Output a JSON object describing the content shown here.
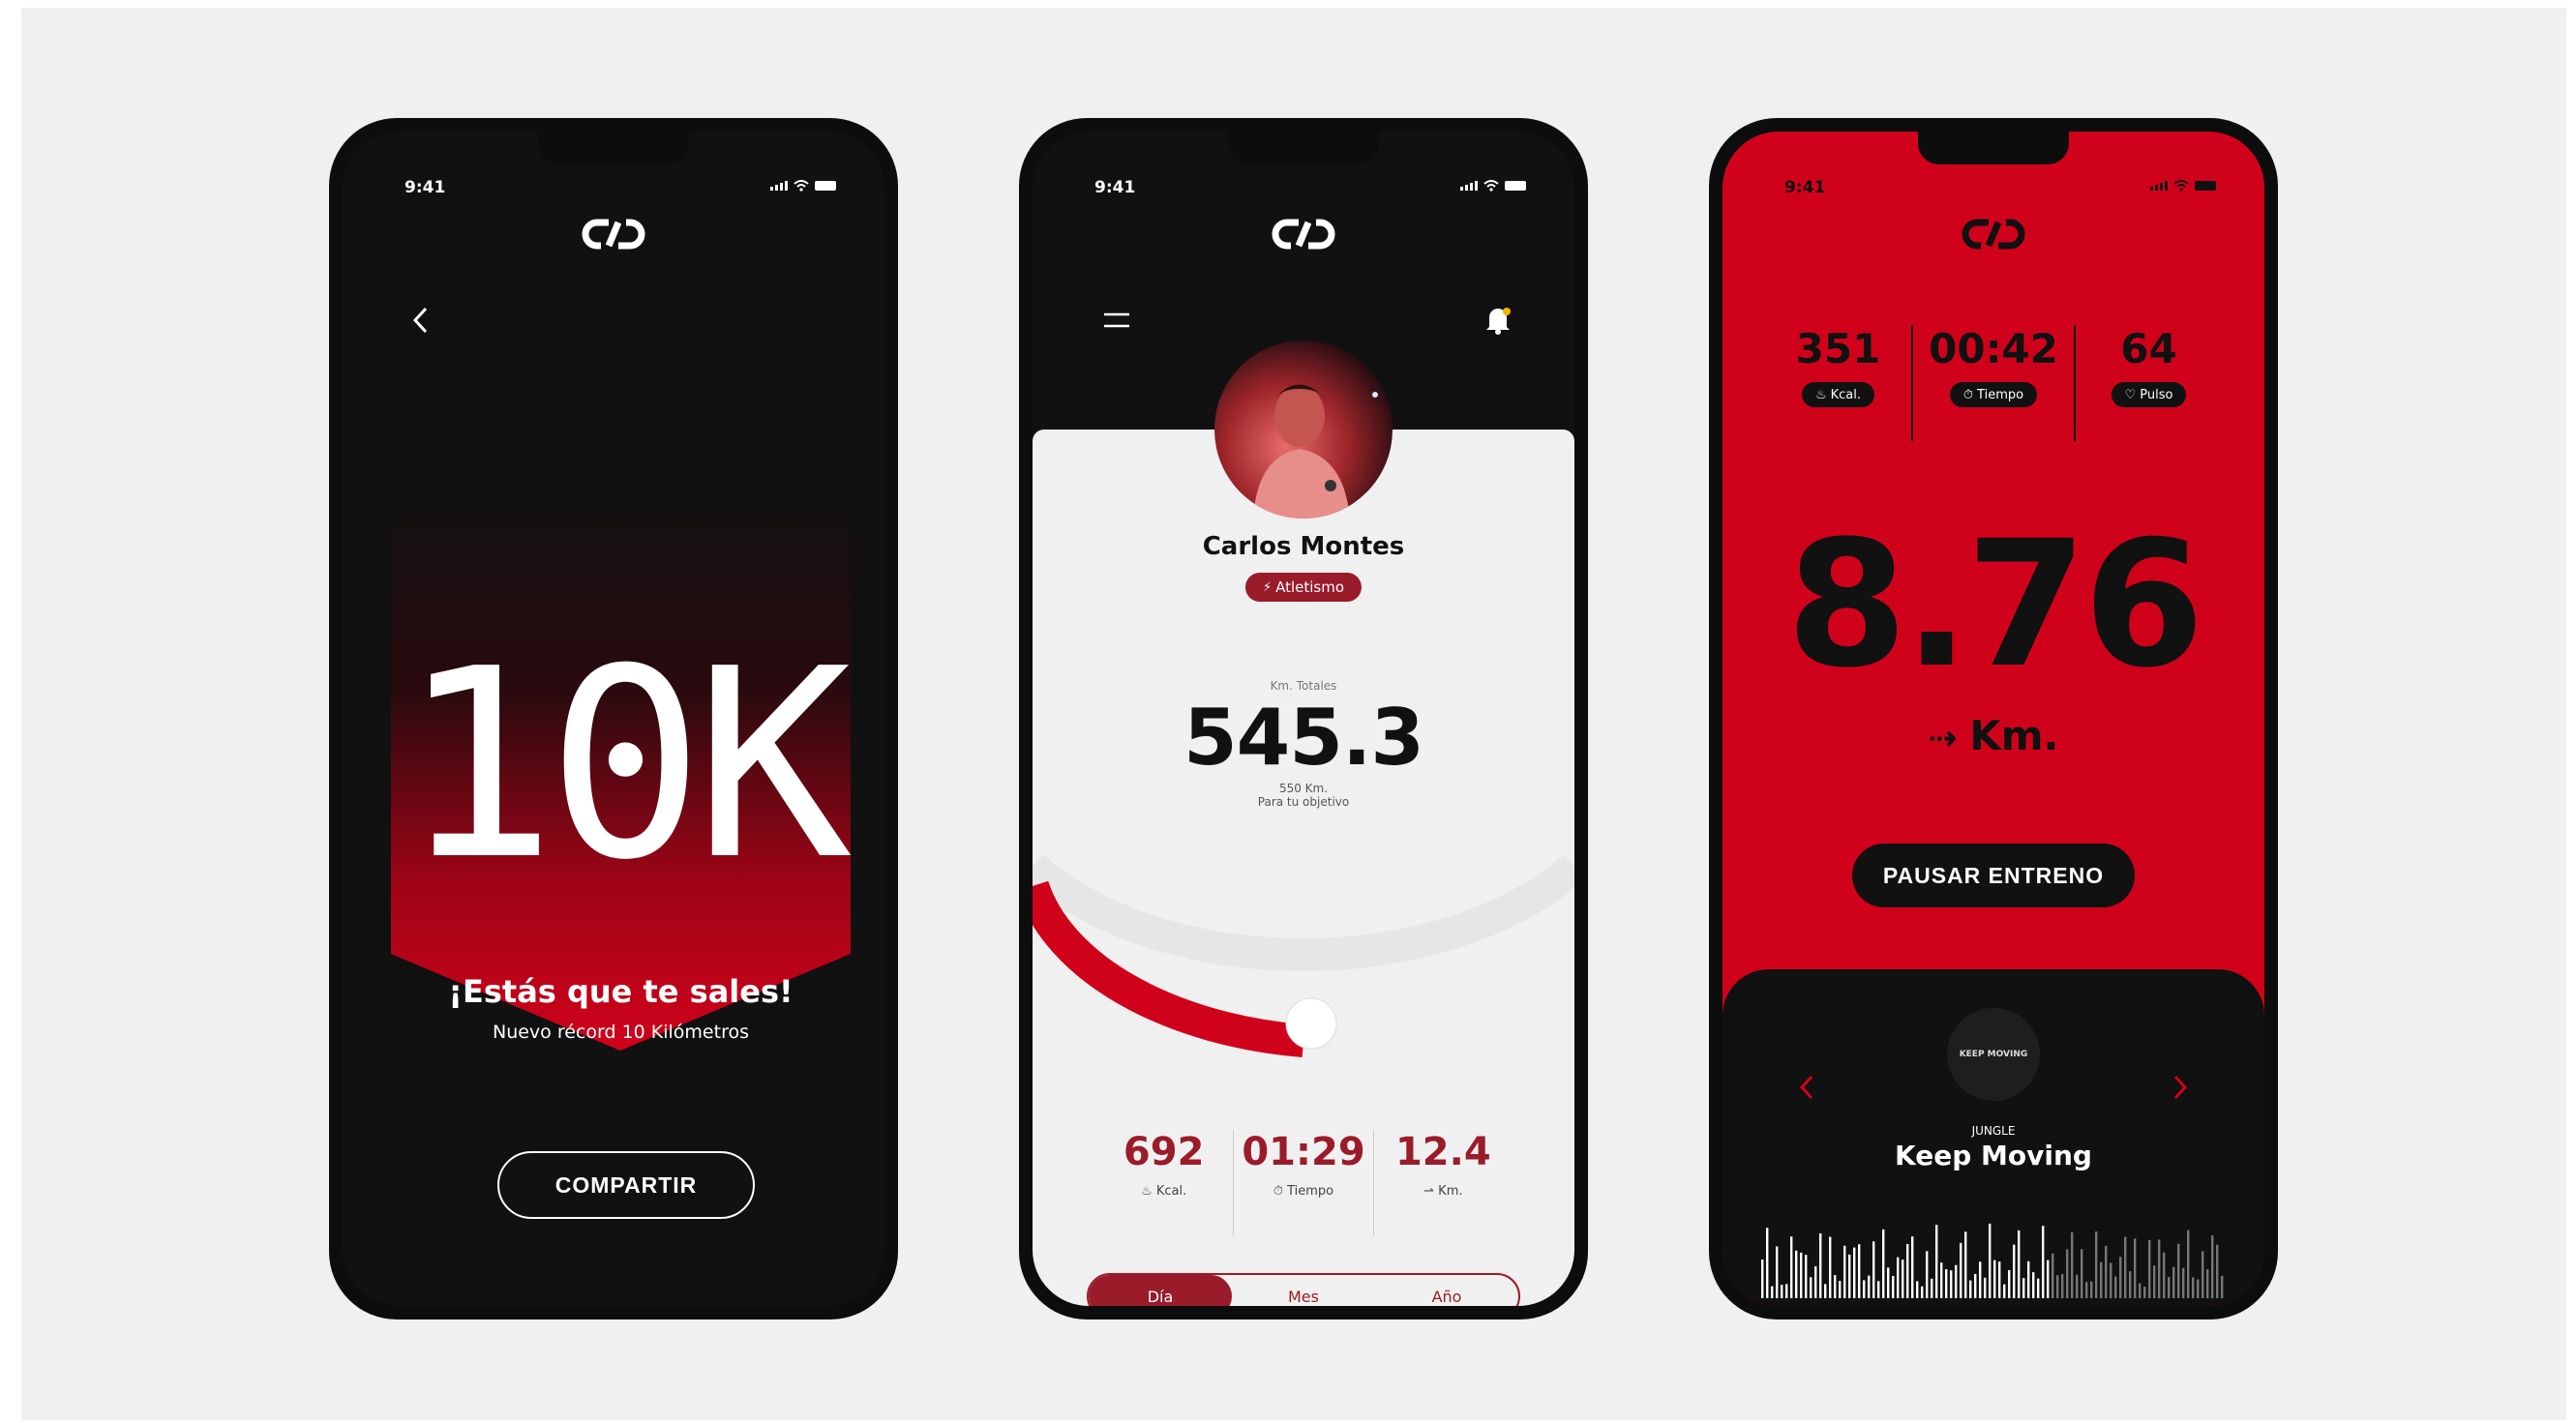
{
  "colors": {
    "brand_red": "#d0021b",
    "dark_red": "#9a1b2a",
    "black": "#111111",
    "light": "#f0f0f0"
  },
  "phone1": {
    "status_time": "9:41",
    "headline": "10K",
    "title": "¡Estás que te sales!",
    "subtitle": "Nuevo récord 10 Kilómetros",
    "share_label": "COMPARTIR",
    "icons": {
      "back": "chevron-left-icon",
      "logo": "brand-logo-icon"
    }
  },
  "phone2": {
    "status_time": "9:41",
    "user_name": "Carlos Montes",
    "sport_tag": "Atletismo",
    "total_label": "Km. Totales",
    "total_value": "545.3",
    "goal_line1": "550 Km.",
    "goal_line2": "Para tu objetivo",
    "goal_progress": 0.991,
    "stats": [
      {
        "value": "692",
        "label": "Kcal.",
        "icon": "flame-icon"
      },
      {
        "value": "01:29",
        "label": "Tiempo",
        "icon": "stopwatch-icon"
      },
      {
        "value": "12.4",
        "label": "Km.",
        "icon": "runner-icon"
      }
    ],
    "tabs": [
      "Día",
      "Mes",
      "Año"
    ],
    "active_tab": "Día",
    "icons": {
      "menu": "hamburger-menu-icon",
      "notifications": "bell-icon"
    }
  },
  "phone3": {
    "status_time": "9:41",
    "stats": [
      {
        "value": "351",
        "label": "Kcal.",
        "icon": "flame-icon"
      },
      {
        "value": "00:42",
        "label": "Tiempo",
        "icon": "stopwatch-icon"
      },
      {
        "value": "64",
        "label": "Pulso",
        "icon": "heart-icon"
      }
    ],
    "distance": "8.76",
    "distance_unit": "Km.",
    "pause_label": "PAUSAR ENTRENO",
    "player": {
      "album_art_text": "KEEP MOVING",
      "artist": "JUNGLE",
      "track": "Keep Moving",
      "icons": {
        "prev": "chevron-left-icon",
        "next": "chevron-right-icon"
      }
    }
  }
}
